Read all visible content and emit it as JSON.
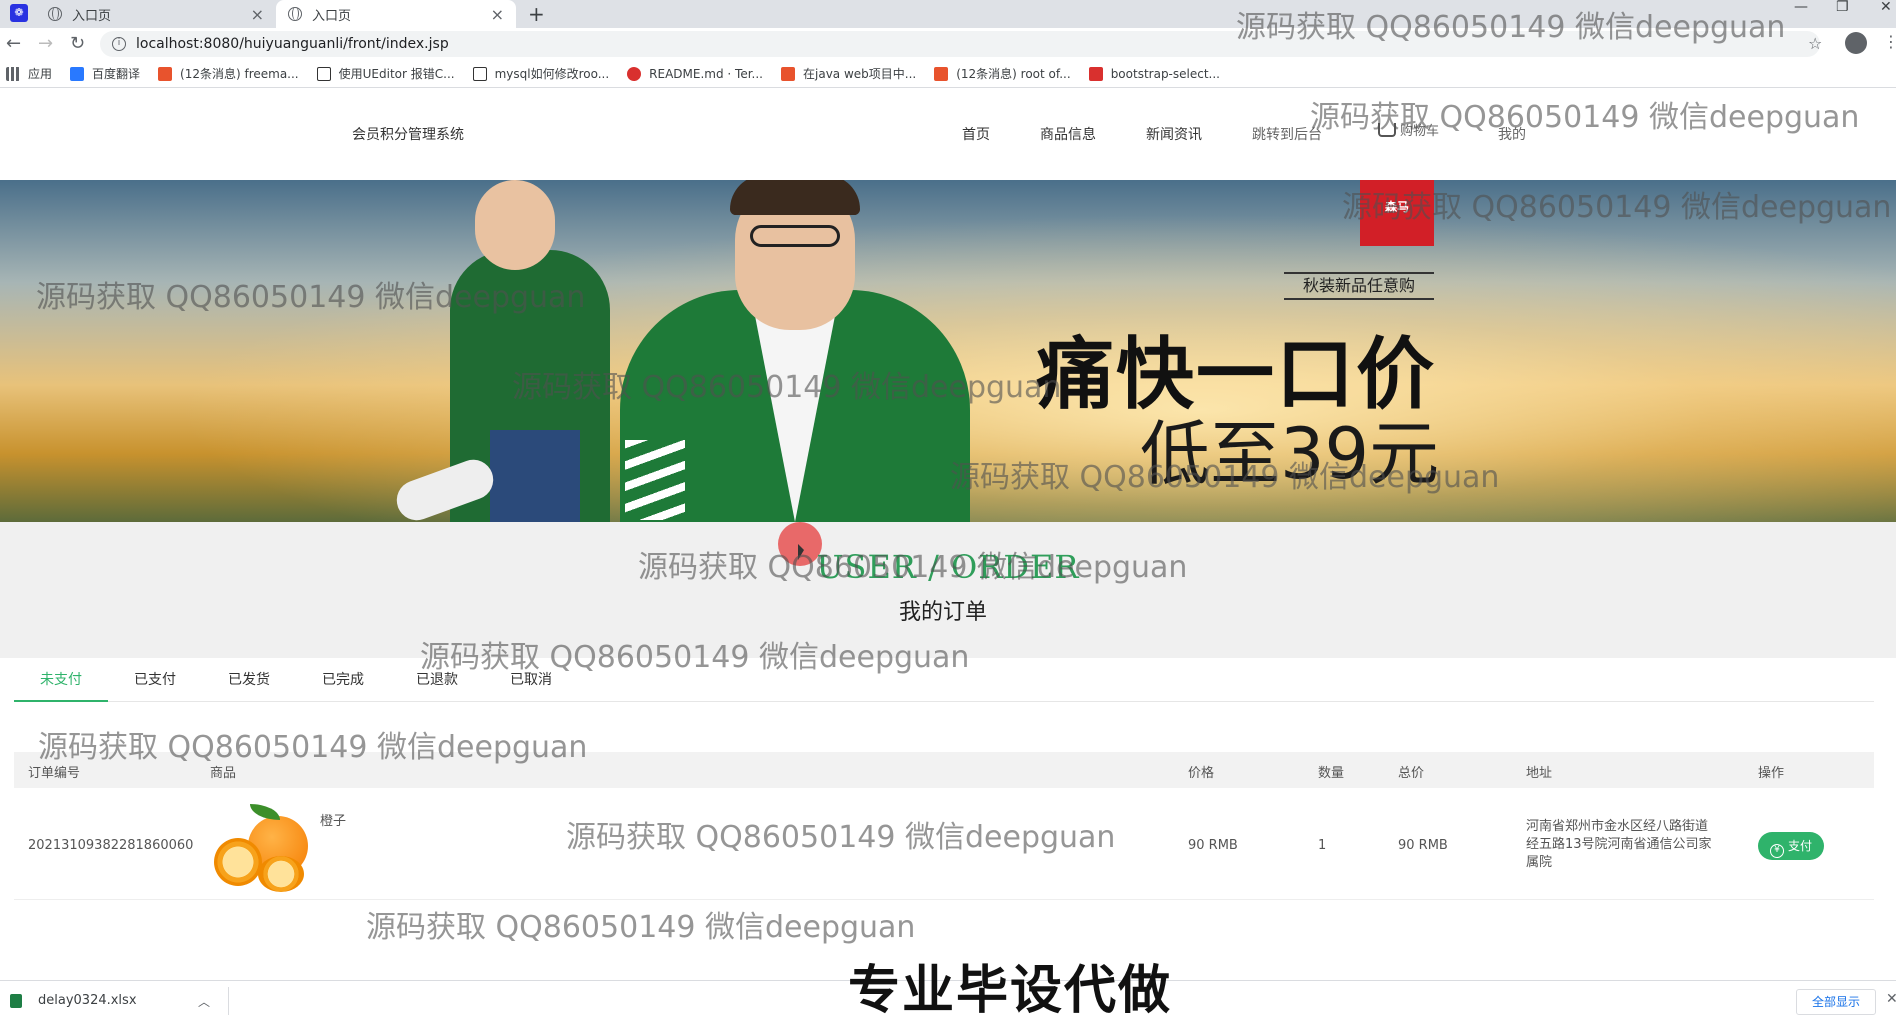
{
  "browser": {
    "tabs": [
      {
        "label": "入口页",
        "active": false
      },
      {
        "label": "入口页",
        "active": true
      }
    ],
    "address": "localhost:8080/huiyuanguanli/front/index.jsp",
    "bookmarks": [
      {
        "label": "应用",
        "color": "#5f6368"
      },
      {
        "label": "百度翻译",
        "color": "#2979ff"
      },
      {
        "label": "(12条消息) freema...",
        "color": "#e8532d"
      },
      {
        "label": "使用UEditor 报错C...",
        "color": "#333333"
      },
      {
        "label": "mysql如何修改roo...",
        "color": "#333333"
      },
      {
        "label": "README.md · Ter...",
        "color": "#d9302e"
      },
      {
        "label": "在java web项目中...",
        "color": "#e8532d"
      },
      {
        "label": "(12条消息) root of...",
        "color": "#e8532d"
      },
      {
        "label": "bootstrap-select...",
        "color": "#d9302e"
      }
    ]
  },
  "site": {
    "logo": "会员积分管理系统",
    "nav": [
      "首页",
      "商品信息",
      "新闻资讯",
      "跳转到后台",
      "购物车",
      "我的"
    ]
  },
  "banner": {
    "brand": "森马",
    "subtitle": "秋装新品任意购",
    "title": "痛快一口价",
    "price": "低至39元"
  },
  "section": {
    "title_en": "USER / ORDER",
    "title_cn": "我的订单"
  },
  "order_tabs": [
    "未支付",
    "已支付",
    "已发货",
    "已完成",
    "已退款",
    "已取消"
  ],
  "table": {
    "headers": [
      "订单编号",
      "商品",
      "价格",
      "数量",
      "总价",
      "地址",
      "操作"
    ],
    "rows": [
      {
        "order_no": "20213109382281860060",
        "product": "橙子",
        "price": "90 RMB",
        "qty": "1",
        "total": "90 RMB",
        "address": [
          "河南省郑州市金水区经八路街道",
          "经五路13号院河南省通信公司家",
          "属院"
        ],
        "action": "支付"
      }
    ]
  },
  "downloads": {
    "file": "delay0324.xlsx",
    "show_all": "全部显示"
  },
  "overlay_caption": "专业毕设代做",
  "watermark": "源码获取 QQ86050149 微信deepguan",
  "colors": {
    "accent": "#2fb36b",
    "section_en": "#2f9e5a"
  }
}
